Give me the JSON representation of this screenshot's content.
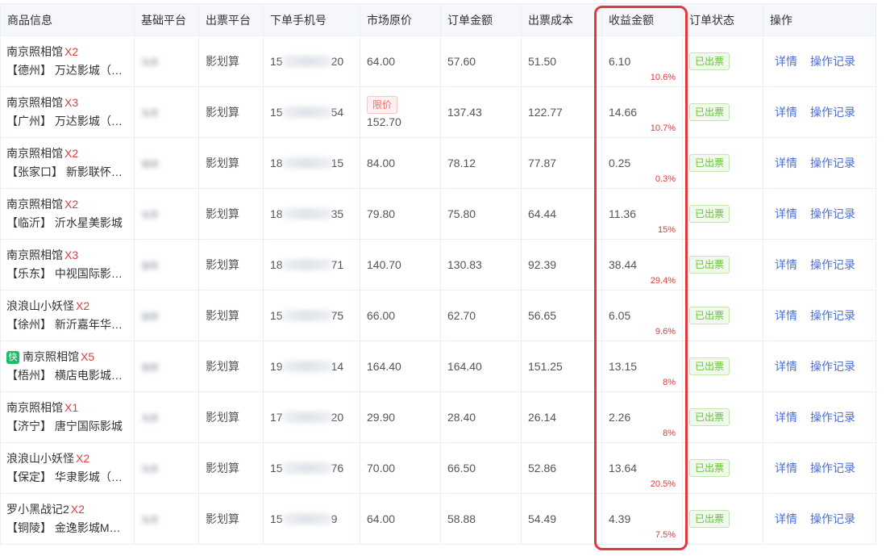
{
  "headers": [
    "商品信息",
    "基础平台",
    "出票平台",
    "下单手机号",
    "市场原价",
    "订单金额",
    "出票成本",
    "收益金额",
    "订单状态",
    "操作"
  ],
  "rows": [
    {
      "movie": "南京照相馆",
      "qty": "X2",
      "fast": false,
      "cinema": "【德州】 万达影城（…",
      "base": "淘票",
      "platform": "影划算",
      "phone_head": "15",
      "phone_tail": "20",
      "limit": "",
      "price": "64.00",
      "order_amount": "57.60",
      "cost": "51.50",
      "profit": "6.10",
      "rate": "10.6%",
      "status": "已出票",
      "detail": "详情",
      "log": "操作记录"
    },
    {
      "movie": "南京照相馆",
      "qty": "X3",
      "fast": false,
      "cinema": "【广州】 万达影城（…",
      "base": "淘票",
      "platform": "影划算",
      "phone_head": "15",
      "phone_tail": "54",
      "limit": "限价",
      "price": "152.70",
      "order_amount": "137.43",
      "cost": "122.77",
      "profit": "14.66",
      "rate": "10.7%",
      "status": "已出票",
      "detail": "详情",
      "log": "操作记录"
    },
    {
      "movie": "南京照相馆",
      "qty": "X2",
      "fast": false,
      "cinema": "【张家口】 新影联怀…",
      "base": "猫眼",
      "platform": "影划算",
      "phone_head": "18",
      "phone_tail": "15",
      "limit": "",
      "price": "84.00",
      "order_amount": "78.12",
      "cost": "77.87",
      "profit": "0.25",
      "rate": "0.3%",
      "status": "已出票",
      "detail": "详情",
      "log": "操作记录"
    },
    {
      "movie": "南京照相馆",
      "qty": "X2",
      "fast": false,
      "cinema": "【临沂】 沂水星美影城",
      "base": "淘票",
      "platform": "影划算",
      "phone_head": "18",
      "phone_tail": "35",
      "limit": "",
      "price": "79.80",
      "order_amount": "75.80",
      "cost": "64.44",
      "profit": "11.36",
      "rate": "15%",
      "status": "已出票",
      "detail": "详情",
      "log": "操作记录"
    },
    {
      "movie": "南京照相馆",
      "qty": "X3",
      "fast": false,
      "cinema": "【乐东】 中视国际影…",
      "base": "猫眼",
      "platform": "影划算",
      "phone_head": "18",
      "phone_tail": "71",
      "limit": "",
      "price": "140.70",
      "order_amount": "130.83",
      "cost": "92.39",
      "profit": "38.44",
      "rate": "29.4%",
      "status": "已出票",
      "detail": "详情",
      "log": "操作记录"
    },
    {
      "movie": "浪浪山小妖怪",
      "qty": "X2",
      "fast": false,
      "cinema": "【徐州】 新沂嘉年华…",
      "base": "猫眼",
      "platform": "影划算",
      "phone_head": "15",
      "phone_tail": "75",
      "limit": "",
      "price": "66.00",
      "order_amount": "62.70",
      "cost": "56.65",
      "profit": "6.05",
      "rate": "9.6%",
      "status": "已出票",
      "detail": "详情",
      "log": "操作记录"
    },
    {
      "movie": "南京照相馆",
      "qty": "X5",
      "fast": true,
      "fast_label": "快",
      "cinema": "【梧州】 横店电影城…",
      "base": "猫眼",
      "platform": "影划算",
      "phone_head": "19",
      "phone_tail": "14",
      "limit": "",
      "price": "164.40",
      "order_amount": "164.40",
      "cost": "151.25",
      "profit": "13.15",
      "rate": "8%",
      "status": "已出票",
      "detail": "详情",
      "log": "操作记录"
    },
    {
      "movie": "南京照相馆",
      "qty": "X1",
      "fast": false,
      "cinema": "【济宁】 唐宁国际影城",
      "base": "淘票",
      "platform": "影划算",
      "phone_head": "17",
      "phone_tail": "20",
      "limit": "",
      "price": "29.90",
      "order_amount": "28.40",
      "cost": "26.14",
      "profit": "2.26",
      "rate": "8%",
      "status": "已出票",
      "detail": "详情",
      "log": "操作记录"
    },
    {
      "movie": "浪浪山小妖怪",
      "qty": "X2",
      "fast": false,
      "cinema": "【保定】 华隶影城（…",
      "base": "淘票",
      "platform": "影划算",
      "phone_head": "15",
      "phone_tail": "76",
      "limit": "",
      "price": "70.00",
      "order_amount": "66.50",
      "cost": "52.86",
      "profit": "13.64",
      "rate": "20.5%",
      "status": "已出票",
      "detail": "详情",
      "log": "操作记录"
    },
    {
      "movie": "罗小黑战记2",
      "qty": "X2",
      "fast": false,
      "cinema": "【铜陵】 金逸影城M…",
      "base": "淘票",
      "platform": "影划算",
      "phone_head": "15",
      "phone_tail": "9",
      "limit": "",
      "price": "64.00",
      "order_amount": "58.88",
      "cost": "54.49",
      "profit": "4.39",
      "rate": "7.5%",
      "status": "已出票",
      "detail": "详情",
      "log": "操作记录"
    }
  ],
  "highlight_color": "#e23a3a"
}
